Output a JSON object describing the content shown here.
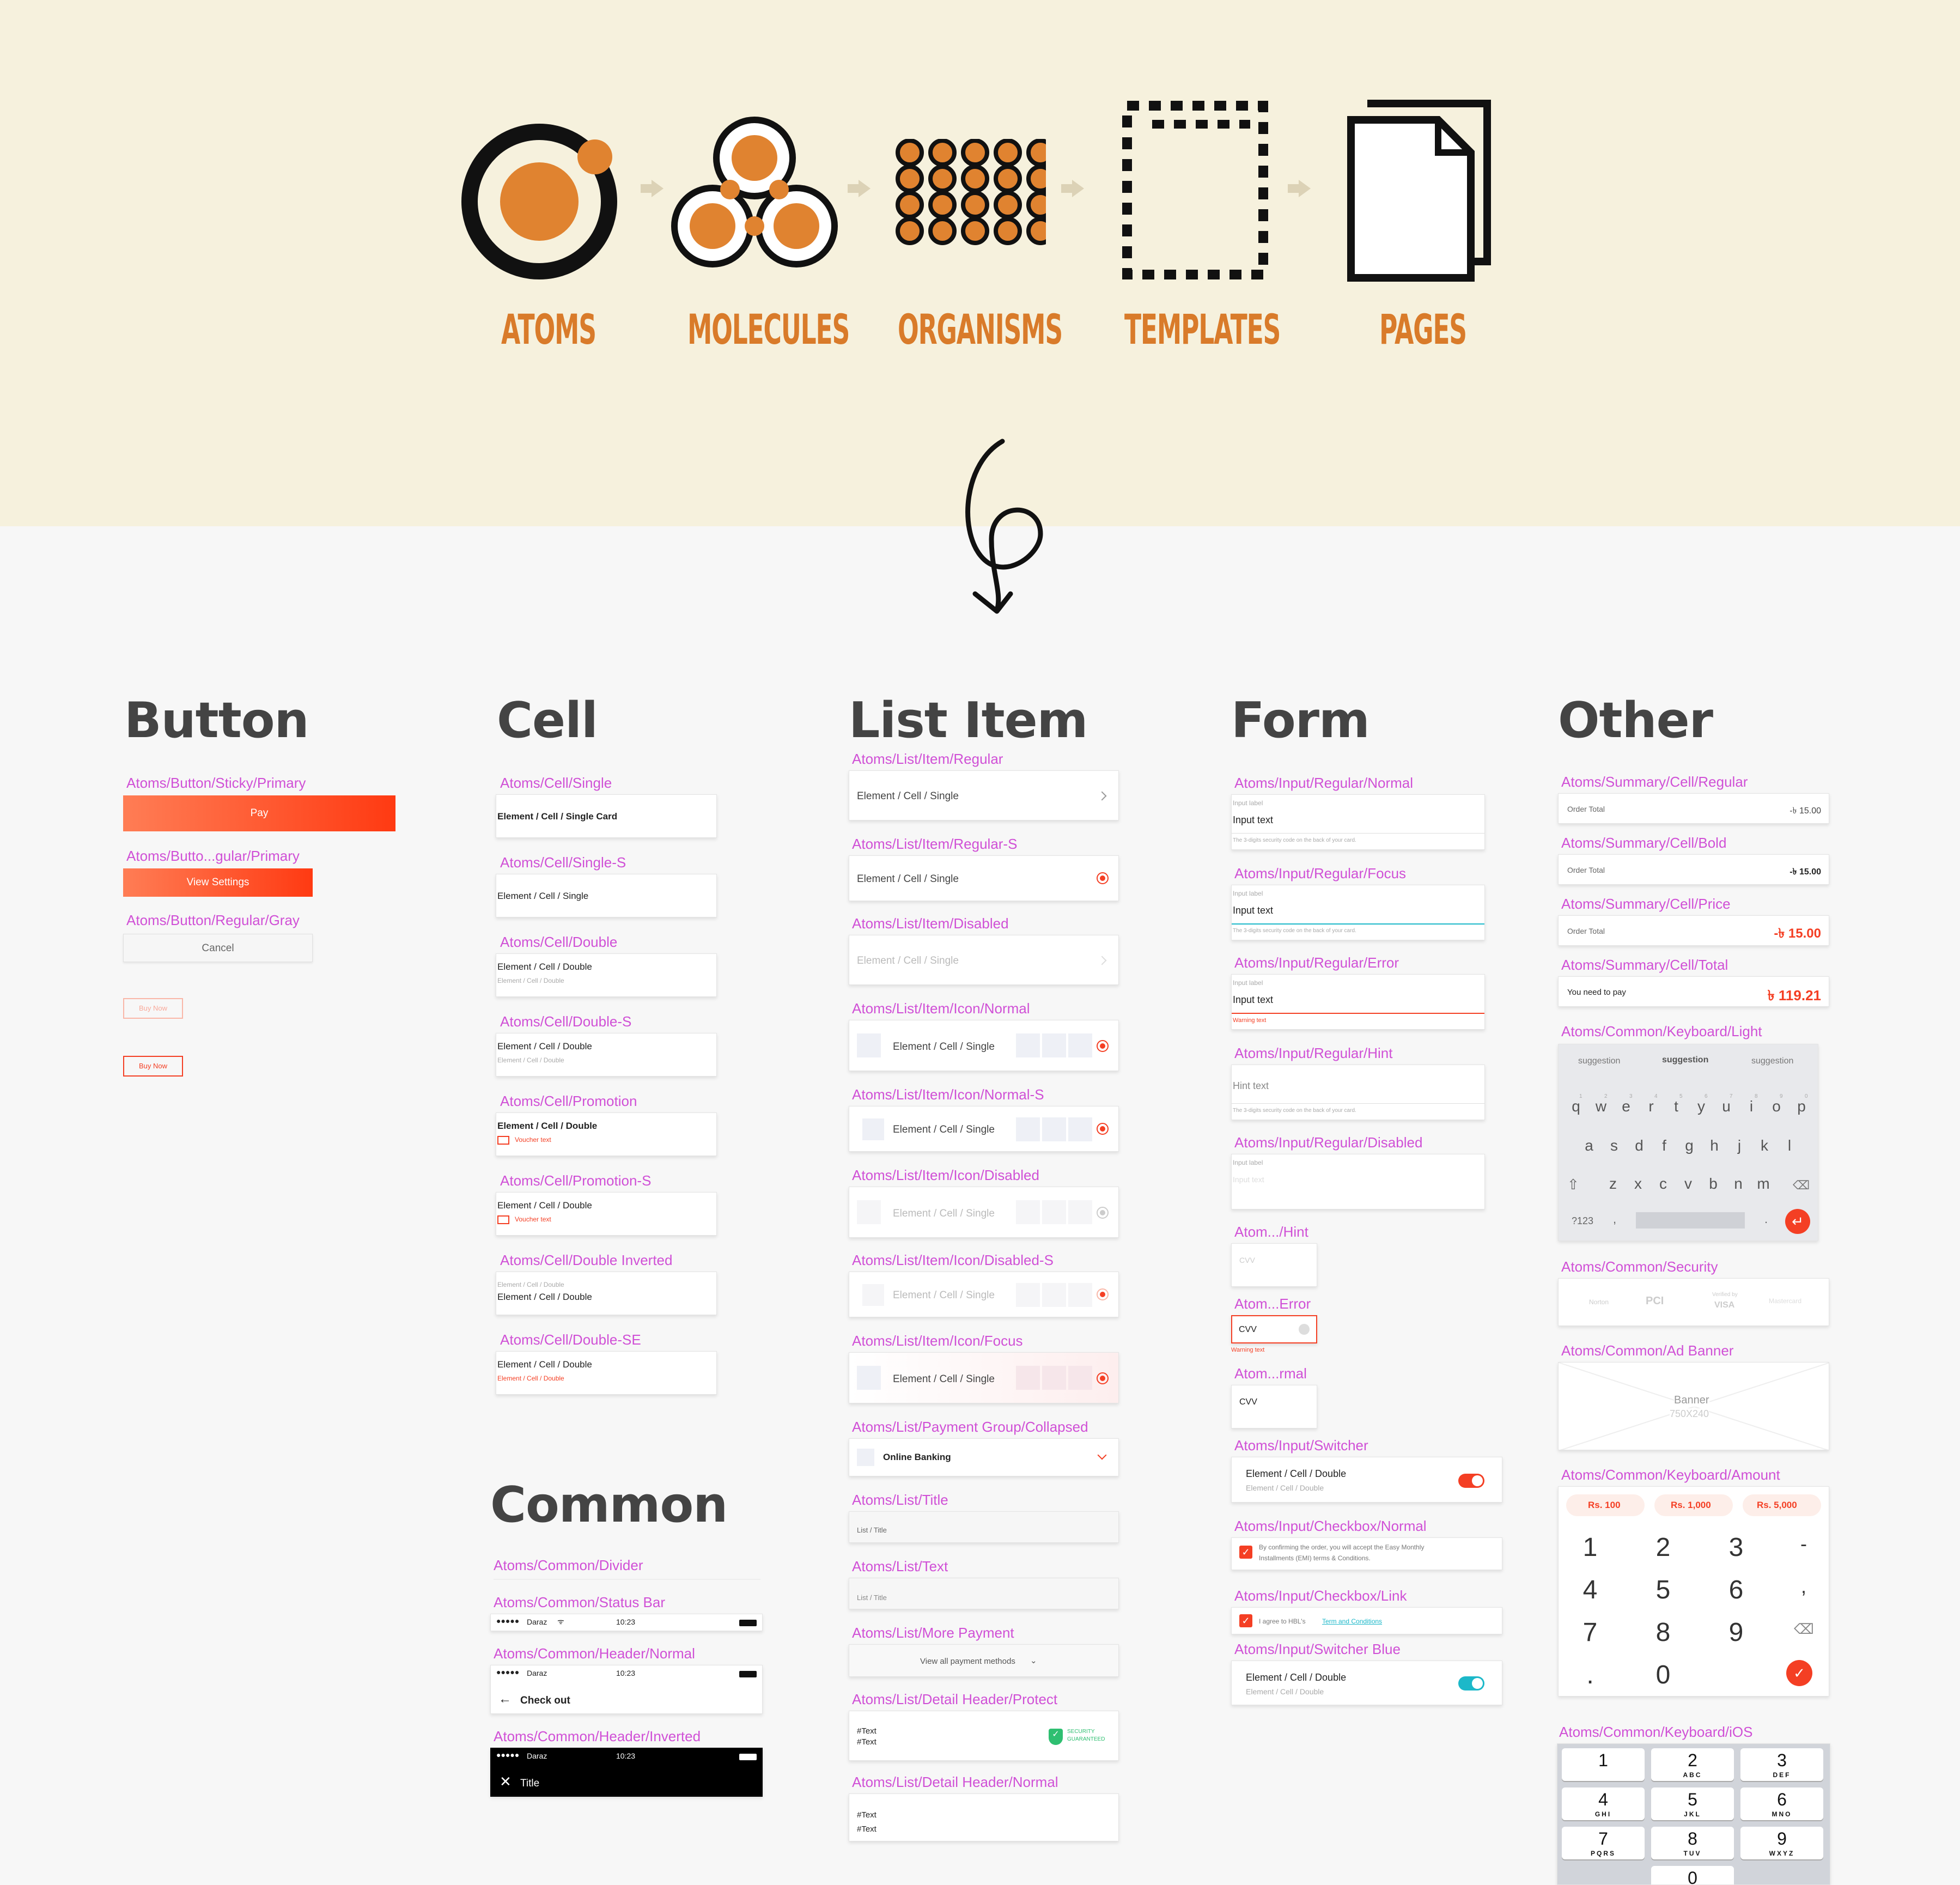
{
  "hero": {
    "stages": [
      "ATOMS",
      "MOLECULES",
      "ORGANISMS",
      "TEMPLATES",
      "PAGES"
    ]
  },
  "columns": {
    "button": "Button",
    "cell": "Cell",
    "list_item": "List Item",
    "form": "Form",
    "other": "Other",
    "common": "Common"
  },
  "button": {
    "sticky_label": "Atoms/Button/Sticky/Primary",
    "sticky_text": "Pay",
    "regular_label": "Atoms/Butto...gular/Primary",
    "regular_text": "View Settings",
    "gray_label": "Atoms/Button/Regular/Gray",
    "gray_text": "Cancel",
    "outline_small_text": "Buy Now",
    "outline_text": "Buy Now"
  },
  "cell": {
    "items": [
      {
        "label": "Atoms/Cell/Single",
        "line1": "Element / Cell / Single Card",
        "line2": ""
      },
      {
        "label": "Atoms/Cell/Single-S",
        "line1": "Element / Cell / Single",
        "line2": ""
      },
      {
        "label": "Atoms/Cell/Double",
        "line1": "Element / Cell / Double",
        "line2": "Element / Cell / Double"
      },
      {
        "label": "Atoms/Cell/Double-S",
        "line1": "Element / Cell / Double",
        "line2": "Element / Cell / Double"
      },
      {
        "label": "Atoms/Cell/Promotion",
        "line1": "Element / Cell / Double",
        "line2": "Voucher text"
      },
      {
        "label": "Atoms/Cell/Promotion-S",
        "line1": "Element / Cell / Double",
        "line2": "Voucher text"
      },
      {
        "label": "Atoms/Cell/Double Inverted",
        "line1": "Element / Cell / Double",
        "line2": "Element / Cell / Double"
      },
      {
        "label": "Atoms/Cell/Double-SE",
        "line1": "Element / Cell / Double",
        "line2": "Element / Cell / Double"
      }
    ]
  },
  "common": {
    "divider_label": "Atoms/Common/Divider",
    "status_label": "Atoms/Common/Status Bar",
    "carrier": "Daraz",
    "time": "10:23",
    "header_normal_label": "Atoms/Common/Header/Normal",
    "header_normal_title": "Check out",
    "header_inverted_label": "Atoms/Common/Header/Inverted",
    "header_inverted_title": "Title"
  },
  "list": {
    "regular_label": "Atoms/List/Item/Regular",
    "regular_text": "Element / Cell / Single",
    "regular_s_label": "Atoms/List/Item/Regular-S",
    "regular_s_text": "Element / Cell / Single",
    "disabled_label": "Atoms/List/Item/Disabled",
    "disabled_text": "Element / Cell / Single",
    "icon_normal_label": "Atoms/List/Item/Icon/Normal",
    "icon_normal_text": "Element / Cell / Single",
    "icon_normal_s_label": "Atoms/List/Item/Icon/Normal-S",
    "icon_normal_s_text": "Element / Cell / Single",
    "icon_disabled_label": "Atoms/List/Item/Icon/Disabled",
    "icon_disabled_text": "Element / Cell / Single",
    "icon_disabled_s_label": "Atoms/List/Item/Icon/Disabled-S",
    "icon_disabled_s_text": "Element / Cell / Single",
    "icon_focus_label": "Atoms/List/Item/Icon/Focus",
    "icon_focus_text": "Element / Cell / Single",
    "payment_label": "Atoms/List/Payment Group/Collapsed",
    "payment_text": "Online Banking",
    "title_label": "Atoms/List/Title",
    "title_text": "List / Title",
    "text_label": "Atoms/List/Text",
    "text_text": "List / Title",
    "more_label": "Atoms/List/More Payment",
    "more_text": "View all payment methods",
    "detail_protect_label": "Atoms/List/Detail Header/Protect",
    "detail_line1": "#Text",
    "detail_line2": "#Text",
    "security_line1": "SECURITY",
    "security_line2": "GUARANTEED",
    "detail_normal_label": "Atoms/List/Detail Header/Normal"
  },
  "form": {
    "normal_label": "Atoms/Input/Regular/Normal",
    "focus_label": "Atoms/Input/Regular/Focus",
    "error_label": "Atoms/Input/Regular/Error",
    "hint_label": "Atoms/Input/Regular/Hint",
    "disabled_label": "Atoms/Input/Regular/Disabled",
    "input_label": "Input label",
    "input_text": "Input text",
    "helper": "The 3-digits security code on the back of your card.",
    "warning": "Warning text",
    "hint_text": "Hint text",
    "cvv_hint_label": "Atom.../Hint",
    "cvv_error_label": "Atom...Error",
    "cvv_normal_label": "Atom...rmal",
    "cvv": "CVV",
    "switcher_label": "Atoms/Input/Switcher",
    "switcher_line1": "Element / Cell / Double",
    "switcher_line2": "Element / Cell / Double",
    "checkbox_label": "Atoms/Input/Checkbox/Normal",
    "checkbox_text1": "By confirming the order, you will accept the Easy Monthly",
    "checkbox_text2": "Installments (EMI) terms & Conditions.",
    "checkbox_link_label": "Atoms/Input/Checkbox/Link",
    "checkbox_link_text": "I agree to HBL's",
    "checkbox_link_anchor": "Term and Conditions",
    "switcher_blue_label": "Atoms/Input/Switcher Blue"
  },
  "other": {
    "summary_regular_label": "Atoms/Summary/Cell/Regular",
    "summary_bold_label": "Atoms/Summary/Cell/Bold",
    "summary_price_label": "Atoms/Summary/Cell/Price",
    "summary_total_label": "Atoms/Summary/Cell/Total",
    "order_total": "Order Total",
    "order_value": "-৳ 15.00",
    "need_to_pay": "You need to pay",
    "total_value": "৳ 119.21",
    "keyboard_light_label": "Atoms/Common/Keyboard/Light",
    "suggestions": [
      "suggestion",
      "suggestion",
      "suggestion"
    ],
    "row1": [
      "q",
      "w",
      "e",
      "r",
      "t",
      "y",
      "u",
      "i",
      "o",
      "p"
    ],
    "row1_nums": [
      "1",
      "2",
      "3",
      "4",
      "5",
      "6",
      "7",
      "8",
      "9",
      "0"
    ],
    "row2": [
      "a",
      "s",
      "d",
      "f",
      "g",
      "h",
      "j",
      "k",
      "l"
    ],
    "row3": [
      "z",
      "x",
      "c",
      "v",
      "b",
      "n",
      "m"
    ],
    "sym_key": "?123",
    "comma_key": ",",
    "dot_key": ".",
    "security_label": "Atoms/Common/Security",
    "security_norton": "Norton",
    "security_pci": "PCI",
    "security_visa_top": "Verified by",
    "security_visa": "VISA",
    "security_mc": "Mastercard",
    "ad_label": "Atoms/Common/Ad Banner",
    "ad_text": "Banner",
    "ad_size": "750X240",
    "amount_label": "Atoms/Common/Keyboard/Amount",
    "amount_chips": [
      "Rs. 100",
      "Rs. 1,000",
      "Rs. 5,000"
    ],
    "amount_keys": [
      "1",
      "2",
      "3",
      "-",
      "4",
      "5",
      "6",
      ",",
      "7",
      "8",
      "9",
      "",
      ".",
      "0"
    ],
    "ios_label": "Atoms/Common/Keyboard/iOS",
    "ios_keys": [
      {
        "n": "1",
        "l": ""
      },
      {
        "n": "2",
        "l": "ABC"
      },
      {
        "n": "3",
        "l": "DEF"
      },
      {
        "n": "4",
        "l": "GHI"
      },
      {
        "n": "5",
        "l": "JKL"
      },
      {
        "n": "6",
        "l": "MNO"
      },
      {
        "n": "7",
        "l": "PQRS"
      },
      {
        "n": "8",
        "l": "TUV"
      },
      {
        "n": "9",
        "l": "WXYZ"
      }
    ],
    "ios_zero": "0"
  },
  "colors": {
    "accent": "#f43f24",
    "label": "#d050d6",
    "hero": "#f6f1dd",
    "orange": "#e08330"
  }
}
